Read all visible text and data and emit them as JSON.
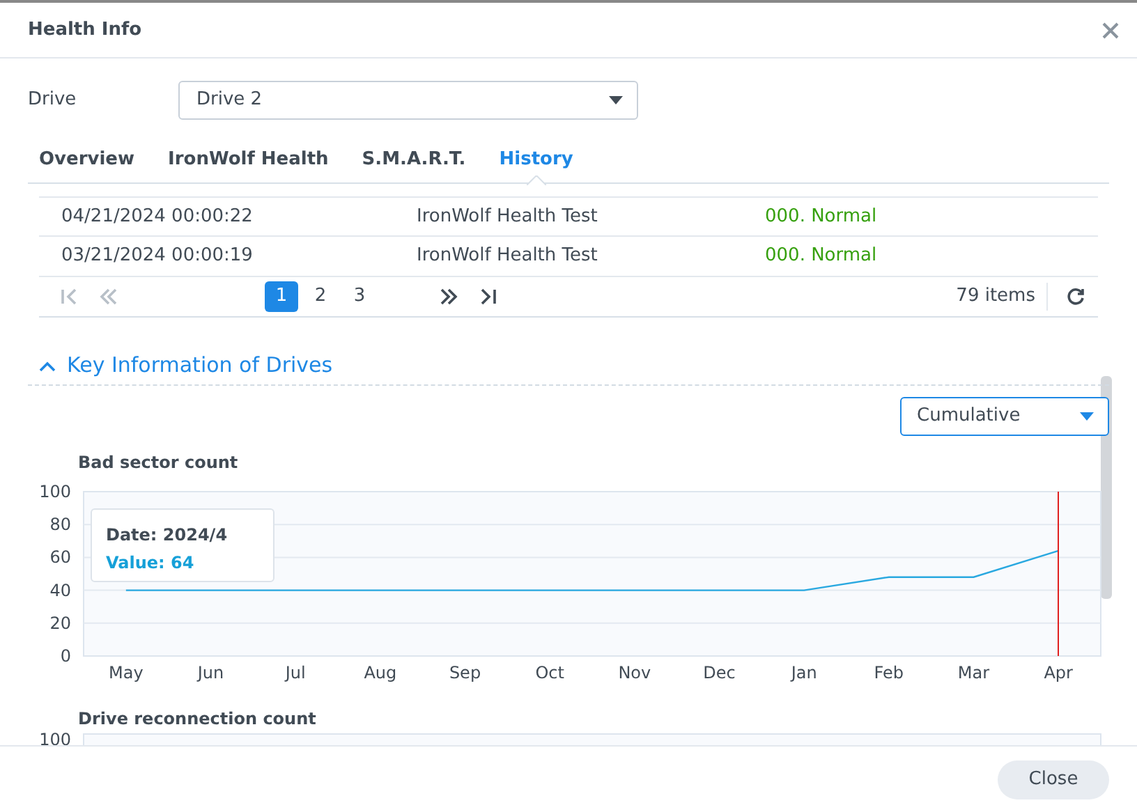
{
  "dialog": {
    "title": "Health Info"
  },
  "drive_field": {
    "label": "Drive",
    "value": "Drive 2"
  },
  "tabs": [
    {
      "label": "Overview",
      "selected": false
    },
    {
      "label": "IronWolf Health",
      "selected": false
    },
    {
      "label": "S.M.A.R.T.",
      "selected": false
    },
    {
      "label": "History",
      "selected": true
    }
  ],
  "history_rows": [
    {
      "time": "04/21/2024 00:00:22",
      "event": "IronWolf Health Test",
      "result": "000. Normal"
    },
    {
      "time": "03/21/2024 00:00:19",
      "event": "IronWolf Health Test",
      "result": "000. Normal"
    }
  ],
  "pagination": {
    "pages": [
      {
        "label": "1",
        "selected": true
      },
      {
        "label": "2",
        "selected": false
      },
      {
        "label": "3",
        "selected": false
      }
    ],
    "total": "79 items"
  },
  "section": {
    "title": "Key Information of Drives",
    "expanded": true
  },
  "mode_select": {
    "value": "Cumulative"
  },
  "charts": [
    {
      "tooltip": {
        "date": "Date: 2024/4",
        "value": "Value: 64"
      },
      "chart_data": {
        "type": "line",
        "title": "Bad sector count",
        "categories": [
          "May",
          "Jun",
          "Jul",
          "Aug",
          "Sep",
          "Oct",
          "Nov",
          "Dec",
          "Jan",
          "Feb",
          "Mar",
          "Apr"
        ],
        "series": [
          {
            "color": "#29a8e0",
            "values": [
              40,
              40,
              40,
              40,
              40,
              40,
              40,
              40,
              40,
              48,
              48,
              64
            ]
          }
        ],
        "ylim": [
          0,
          100
        ],
        "yticks": [
          0,
          20,
          40,
          60,
          80,
          100
        ],
        "grid": true
      }
    }
  ],
  "partial_chart": {
    "title": "Drive reconnection count",
    "top_tick": "100"
  },
  "buttons": [
    {
      "label": "Close"
    }
  ]
}
